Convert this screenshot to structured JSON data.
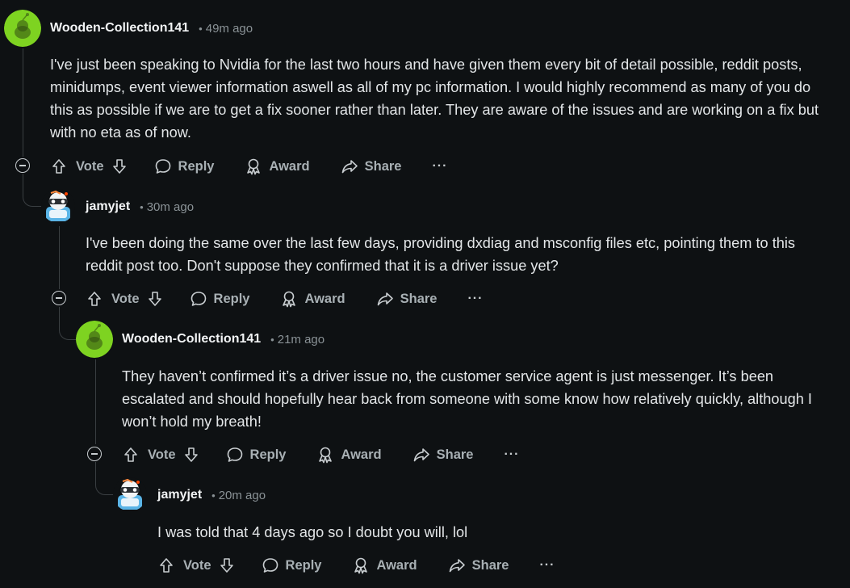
{
  "comments": [
    {
      "author": "Wooden-Collection141",
      "time": "49m ago",
      "body": "I've just been speaking to Nvidia for the last two hours and have given them every bit of detail possible, reddit posts, minidumps, event viewer information aswell as all of my pc information. I would highly recommend as many of you do this as possible if we are to get a fix sooner rather than later. They are aware of the issues and are working on a fix but with no eta as of now.",
      "avatar_icon": "snoo-green-avatar"
    },
    {
      "author": "jamyjet",
      "time": "30m ago",
      "body": "I've been doing the same over the last few days, providing dxdiag and msconfig files etc, pointing them to this reddit post too. Don't suppose they confirmed that it is a driver issue yet?",
      "avatar_icon": "snoo-robot-avatar"
    },
    {
      "author": "Wooden-Collection141",
      "time": "21m ago",
      "body": "They haven’t confirmed it’s a driver issue no, the customer service agent is just messenger. It’s been escalated and should hopefully hear back from someone with some know how relatively quickly, although I won’t hold my breath!",
      "avatar_icon": "snoo-green-avatar"
    },
    {
      "author": "jamyjet",
      "time": "20m ago",
      "body": "I was told that 4 days ago so I doubt you will, lol",
      "avatar_icon": "snoo-robot-avatar"
    }
  ],
  "actions": {
    "vote": "Vote",
    "reply": "Reply",
    "award": "Award",
    "share": "Share",
    "more": "···"
  },
  "meta": {
    "separator": "•"
  },
  "colors": {
    "background": "#0e1113",
    "text": "#d7dadc",
    "muted": "#8a9296",
    "avatar_green": "#7ed321"
  }
}
